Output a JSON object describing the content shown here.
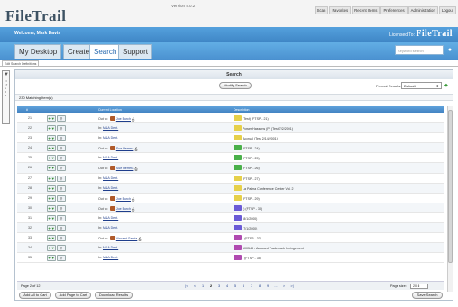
{
  "app": {
    "logo": "FileTrail",
    "version": "Version 4.0.2"
  },
  "topnav": [
    "Scan",
    "Favorites",
    "Recent Items",
    "Preferences",
    "Administration",
    "Logout"
  ],
  "welcome": "Welcome, Mark Davis",
  "licensed": {
    "label": "Licensed To:",
    "name": "FileTrail"
  },
  "tabs": [
    "My Desktop",
    "Create",
    "Search",
    "Support"
  ],
  "active_tab": "Search",
  "keyword_search": {
    "placeholder": "Keyword search"
  },
  "subtab": "Edit Search Definitions",
  "left_strip_text": "FILTERS",
  "search": {
    "title": "Search",
    "modify_label": "Modify Search",
    "format_label": "Format Results:",
    "format_value": "Default",
    "matching": "230 Matching Item(s)"
  },
  "columns": {
    "num": "#",
    "location": "Current Location",
    "description": "Description"
  },
  "rows": [
    {
      "num": "21",
      "loc_prefix": "Out to:",
      "loc_name": "Joe Burch",
      "person": true,
      "printer": true,
      "icon_color": "#e6d04a",
      "desc": "(Test) (FTSP - 21)"
    },
    {
      "num": "22",
      "loc_prefix": "In:",
      "loc_name": "M&A Dept.",
      "person": false,
      "printer": false,
      "icon_color": "#e6d04a",
      "desc": "Power Hassens (P) (Test 7/2/2001)"
    },
    {
      "num": "23",
      "loc_prefix": "In:",
      "loc_name": "M&A Dept.",
      "person": false,
      "printer": false,
      "icon_color": "#e6d04a",
      "desc": "Accrual (Test 2/14/2001)"
    },
    {
      "num": "24",
      "loc_prefix": "Out to:",
      "loc_name": "Sue Herrera",
      "person": true,
      "printer": true,
      "icon_color": "#4ab04a",
      "desc": "(FTSP - 24)"
    },
    {
      "num": "25",
      "loc_prefix": "In:",
      "loc_name": "M&A Dept.",
      "person": false,
      "printer": false,
      "icon_color": "#4ab04a",
      "desc": "(FTSP - 25)"
    },
    {
      "num": "26",
      "loc_prefix": "Out to:",
      "loc_name": "Sue Herrera",
      "person": true,
      "printer": true,
      "icon_color": "#4ab04a",
      "desc": "(FTSP - 26)"
    },
    {
      "num": "27",
      "loc_prefix": "In:",
      "loc_name": "M&A Dept.",
      "person": false,
      "printer": false,
      "icon_color": "#e6d04a",
      "desc": "(FTSP - 27)"
    },
    {
      "num": "28",
      "loc_prefix": "In:",
      "loc_name": "M&A Dept.",
      "person": false,
      "printer": false,
      "icon_color": "#e6d04a",
      "desc": "La Palma Conference Center Vol. 2"
    },
    {
      "num": "29",
      "loc_prefix": "Out to:",
      "loc_name": "Joe Burch",
      "person": true,
      "printer": true,
      "icon_color": "#e6d04a",
      "desc": "(FTSP - 29)"
    },
    {
      "num": "30",
      "loc_prefix": "Out to:",
      "loc_name": "Joe Burch",
      "person": true,
      "printer": true,
      "icon_color": "#6b5bd6",
      "desc": "() (FTSP - 30)"
    },
    {
      "num": "31",
      "loc_prefix": "In:",
      "loc_name": "M&A Dept.",
      "person": false,
      "printer": false,
      "icon_color": "#6b5bd6",
      "desc": "(8/1/2000)"
    },
    {
      "num": "32",
      "loc_prefix": "In:",
      "loc_name": "M&A Dept.",
      "person": false,
      "printer": false,
      "icon_color": "#6b5bd6",
      "desc": "(7/1/2000)"
    },
    {
      "num": "33",
      "loc_prefix": "Out to:",
      "loc_name": "Vincent Garcia",
      "person": true,
      "printer": true,
      "icon_color": "#b04ab0",
      "desc": "- (FTSP - 33)"
    },
    {
      "num": "34",
      "loc_prefix": "In:",
      "loc_name": "M&A Dept.",
      "person": false,
      "printer": false,
      "icon_color": "#b04ab0",
      "desc": "100543 - Accused Trademark Infringement"
    },
    {
      "num": "35",
      "loc_prefix": "In:",
      "loc_name": "M&A Dept.",
      "person": false,
      "printer": false,
      "icon_color": "#b04ab0",
      "desc": "- (FTSP - 35)"
    }
  ],
  "pager": {
    "page_of": "Page 2 of 12",
    "pages": [
      "|<",
      "<",
      "1",
      "2",
      "3",
      "4",
      "5",
      "6",
      "7",
      "8",
      "9",
      "...",
      ">",
      ">|"
    ],
    "current": "2",
    "size_label": "Page size:",
    "size_value": "20"
  },
  "bottom_buttons": [
    "Add All to Cart",
    "Add Page to Cart",
    "Download Results"
  ],
  "save_search": "Save Search"
}
